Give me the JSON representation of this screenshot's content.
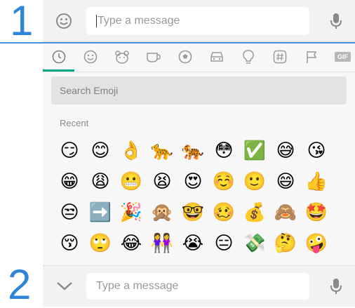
{
  "steps": {
    "first": "1",
    "second": "2"
  },
  "top_bar": {
    "placeholder": "Type a message",
    "emoji_button_icon": "smiley-icon",
    "mic_icon": "microphone-icon"
  },
  "emoji_panel": {
    "tabs": [
      {
        "icon": "clock-icon",
        "label": "Recent",
        "active": true
      },
      {
        "icon": "smiley-icon",
        "label": "Smileys"
      },
      {
        "icon": "animal-icon",
        "label": "Animals"
      },
      {
        "icon": "cup-icon",
        "label": "Food"
      },
      {
        "icon": "ball-icon",
        "label": "Activity"
      },
      {
        "icon": "car-icon",
        "label": "Travel"
      },
      {
        "icon": "bulb-icon",
        "label": "Objects"
      },
      {
        "icon": "hash-icon",
        "label": "Symbols"
      },
      {
        "icon": "flag-icon",
        "label": "Flags"
      },
      {
        "icon": "gif-icon",
        "label": "GIF"
      }
    ],
    "gif_text": "GIF",
    "search_placeholder": "Search Emoji",
    "section_label": "Recent",
    "rows": [
      [
        "😏",
        "😊",
        "👌",
        "🐆",
        "🐅",
        "😳",
        "✅",
        "😅",
        "😘"
      ],
      [
        "😁",
        "😩",
        "😬",
        "😫",
        "😍",
        "☺️",
        "🙂",
        "😄",
        "👍"
      ],
      [
        "😒",
        "➡️",
        "🎉",
        "🙊",
        "🤓",
        "🥴",
        "💰",
        "🙈",
        "🤩"
      ],
      [
        "😚",
        "🙄",
        "😂",
        "👭",
        "😭",
        "😑",
        "💸",
        "🤔",
        "🤪"
      ]
    ]
  },
  "bottom_bar": {
    "placeholder": "Type a message",
    "collapse_icon": "chevron-down-icon",
    "mic_icon": "microphone-icon"
  },
  "colors": {
    "accent": "#00a884",
    "step_blue": "#2f86d8"
  }
}
